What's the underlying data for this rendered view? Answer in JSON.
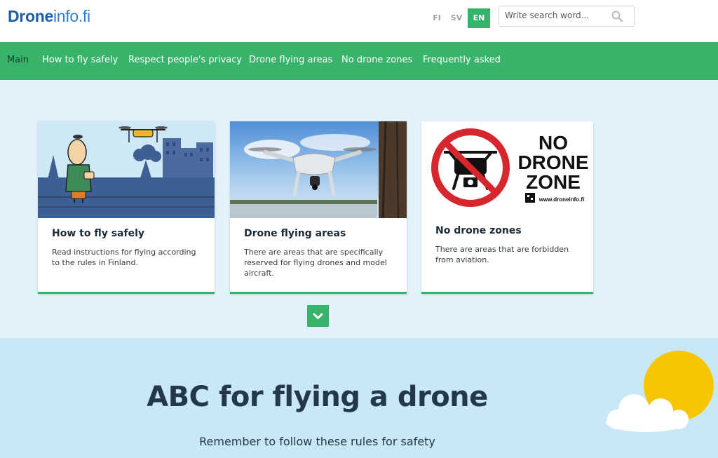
{
  "header": {
    "logo_bold": "Drone",
    "logo_rest": "info.fi",
    "languages": [
      "FI",
      "SV",
      "EN"
    ],
    "active_language": "EN",
    "search_placeholder": "Write search word...",
    "search_icon": "search-icon"
  },
  "nav": {
    "items": [
      {
        "label": "Main",
        "active": true
      },
      {
        "label": "How to fly safely"
      },
      {
        "label": "Respect people's privacy"
      },
      {
        "label": "Drone flying areas"
      },
      {
        "label": "No drone zones"
      },
      {
        "label": "Frequently asked"
      }
    ]
  },
  "cards": [
    {
      "title": "How to fly safely",
      "description": "Read instructions for flying according to the rules in Finland."
    },
    {
      "title": "Drone flying areas",
      "description": "There are areas that are specifically reserved for flying drones and model aircraft."
    },
    {
      "title": "No drone zones",
      "description": "There are areas that are forbidden from aviation.",
      "sign_lines": [
        "NO",
        "DRONE",
        "ZONE"
      ],
      "sign_url": "www.droneinfo.fi"
    }
  ],
  "scroll_down_icon": "chevron-down-icon",
  "abc": {
    "title": "ABC for flying a drone",
    "subtitle": "Remember to follow these rules for safety"
  },
  "colors": {
    "brand_green": "#37b46a",
    "brand_blue": "#1a5fa8",
    "page_bg": "#e3f1fa",
    "abc_bg": "#c8e8f8",
    "sun": "#f7c600"
  }
}
